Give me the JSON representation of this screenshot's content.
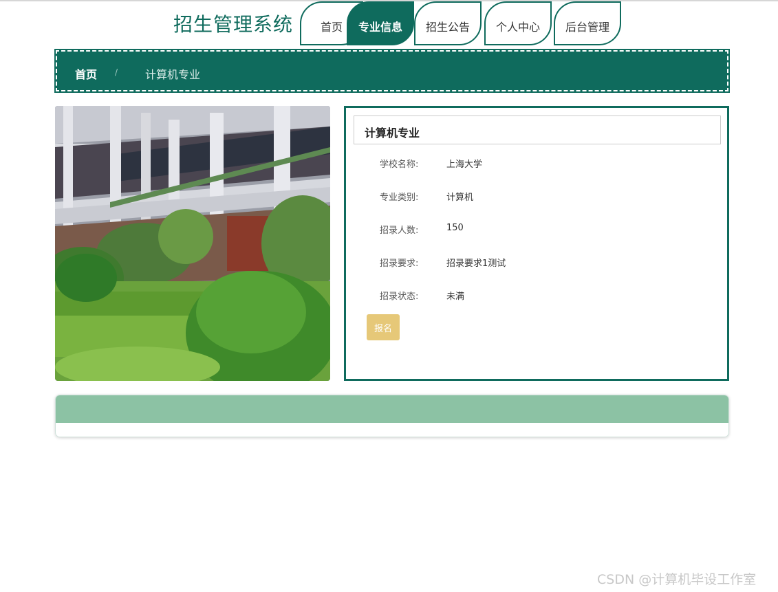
{
  "header": {
    "site_title": "招生管理系统",
    "nav": [
      {
        "label": "首页",
        "active": false
      },
      {
        "label": "专业信息",
        "active": true
      },
      {
        "label": "招生公告",
        "active": false
      },
      {
        "label": "个人中心",
        "active": false
      },
      {
        "label": "后台管理",
        "active": false
      }
    ]
  },
  "breadcrumb": {
    "home": "首页",
    "separator": "/",
    "current": "计算机专业"
  },
  "detail": {
    "title": "计算机专业",
    "fields": [
      {
        "label": "学校名称:",
        "value": "上海大学"
      },
      {
        "label": "专业类别:",
        "value": "计算机"
      },
      {
        "label": "招录人数:",
        "value": "150"
      },
      {
        "label": "招录要求:",
        "value": "招录要求1测试"
      },
      {
        "label": "招录状态:",
        "value": "未满"
      }
    ],
    "apply_button": "报名"
  },
  "watermark": "CSDN @计算机毕设工作室",
  "colors": {
    "primary": "#0f6b5d",
    "accent_button": "#e6c878",
    "card_header": "#8cc2a4"
  }
}
